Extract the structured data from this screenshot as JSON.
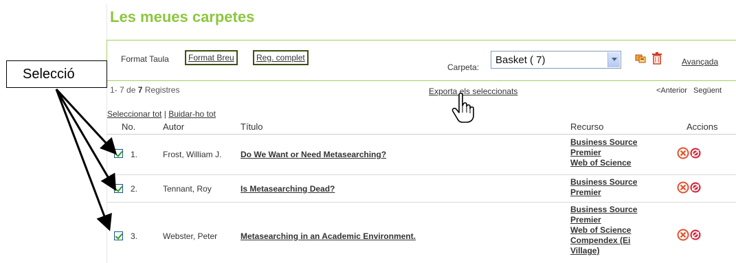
{
  "page": {
    "title": "Les meues carpetes"
  },
  "toolbar": {
    "format_label": "Format Taula",
    "format_brief": "Format Breu",
    "full_record": "Reg. complet",
    "folder_label": "Carpeta:",
    "folder_value": "Basket ( 7)",
    "advanced": "Avançada"
  },
  "records": {
    "range": "1- 7",
    "de": "de",
    "total": "7",
    "label": "Registres",
    "export_selected": "Exporta els seleccionats",
    "previous": "<Anterior",
    "next": "Següent"
  },
  "selection": {
    "select_all": "Seleccionar tot",
    "separator": "|",
    "clear_all": "Buidar-ho tot"
  },
  "table": {
    "headers": {
      "no": "No.",
      "author": "Autor",
      "title": "Título",
      "resource": "Recurso",
      "actions": "Accions"
    },
    "rows": [
      {
        "num": "1.",
        "author": "Frost, William J.",
        "title": "Do We Want or Need Metasearching?",
        "resources": [
          "Business Source",
          "Premier",
          "Web of Science"
        ],
        "checked": true
      },
      {
        "num": "2.",
        "author": "Tennant, Roy",
        "title": "Is Metasearching Dead?",
        "resources": [
          "Business Source",
          "Premier"
        ],
        "checked": true
      },
      {
        "num": "3.",
        "author": "Webster, Peter",
        "title": "Metasearching in an Academic Environment.",
        "resources": [
          "Business Source",
          "Premier",
          "Web of Science",
          "Compendex (Ei",
          "Village)"
        ],
        "checked": true
      }
    ]
  },
  "annotation": {
    "label": "Selecció"
  },
  "icons": {
    "export": "export-folder-icon",
    "delete": "trash-icon",
    "remove": "remove-circle-icon",
    "sfx": "sfx-link-icon",
    "cursor": "hand-cursor-icon"
  },
  "colors": {
    "accent": "#8dc63f",
    "rule": "#a6cf5b",
    "remove": "#e2522b"
  }
}
